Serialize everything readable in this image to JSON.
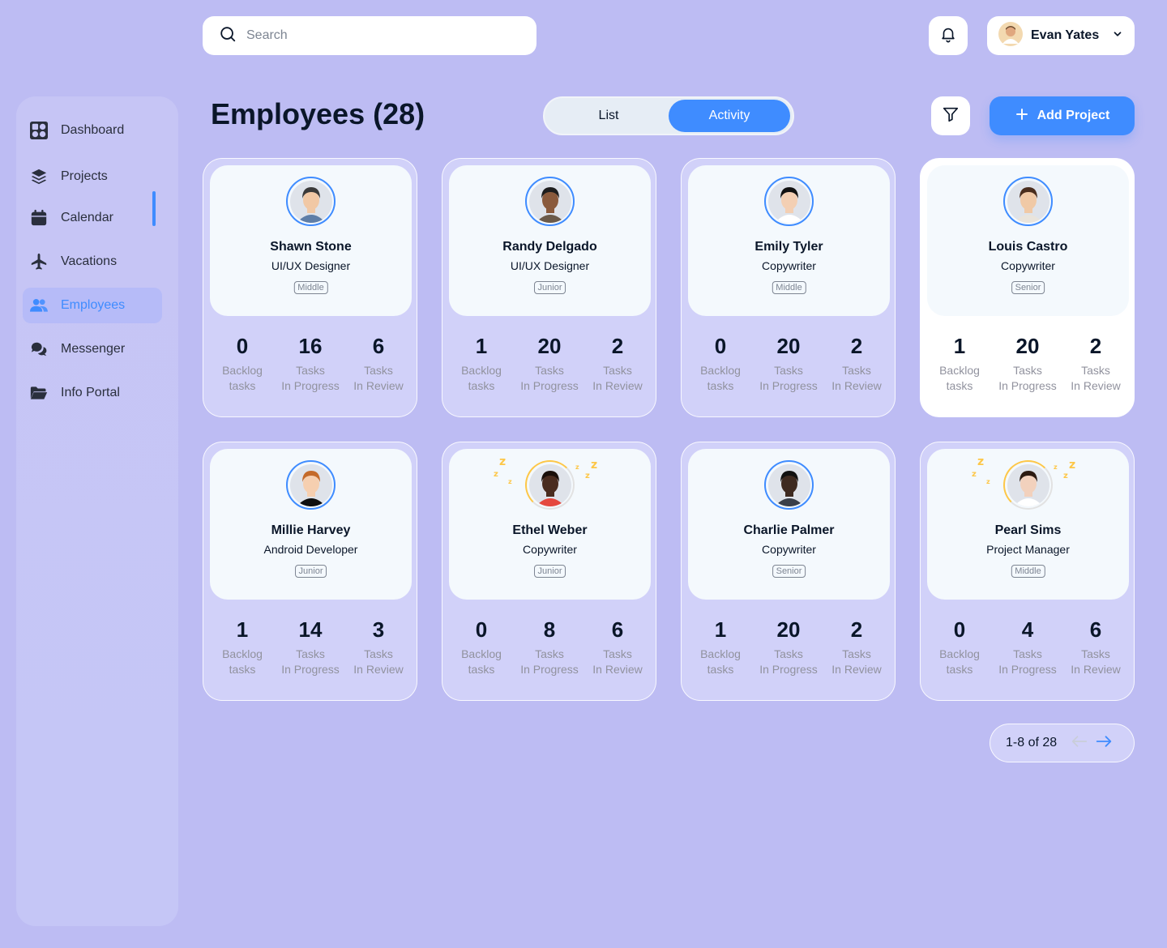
{
  "search": {
    "placeholder": "Search"
  },
  "user": {
    "name": "Evan Yates"
  },
  "sidebar": {
    "items": [
      {
        "label": "Dashboard",
        "icon": "dashboard-icon"
      },
      {
        "label": "Projects",
        "icon": "layers-icon"
      },
      {
        "label": "Calendar",
        "icon": "calendar-icon"
      },
      {
        "label": "Vacations",
        "icon": "airplane-icon"
      },
      {
        "label": "Employees",
        "icon": "users-icon",
        "active": true
      },
      {
        "label": "Messenger",
        "icon": "chat-icon"
      },
      {
        "label": "Info Portal",
        "icon": "folder-icon"
      }
    ]
  },
  "header": {
    "title": "Employees (28)",
    "view_toggle": {
      "list": "List",
      "activity": "Activity",
      "selected": "Activity"
    },
    "add_label": "Add Project"
  },
  "stat_labels": {
    "backlog_1": "Backlog",
    "backlog_2": "tasks",
    "progress_1": "Tasks",
    "progress_2": "In Progress",
    "review_1": "Tasks",
    "review_2": "In Review"
  },
  "employees": [
    {
      "name": "Shawn Stone",
      "role": "UI/UX Designer",
      "level": "Middle",
      "backlog": "0",
      "in_progress": "16",
      "in_review": "6",
      "status": "active"
    },
    {
      "name": "Randy Delgado",
      "role": "UI/UX Designer",
      "level": "Junior",
      "backlog": "1",
      "in_progress": "20",
      "in_review": "2",
      "status": "active"
    },
    {
      "name": "Emily Tyler",
      "role": "Copywriter",
      "level": "Middle",
      "backlog": "0",
      "in_progress": "20",
      "in_review": "2",
      "status": "active"
    },
    {
      "name": "Louis Castro",
      "role": "Copywriter",
      "level": "Senior",
      "backlog": "1",
      "in_progress": "20",
      "in_review": "2",
      "status": "active",
      "highlighted": true
    },
    {
      "name": "Millie Harvey",
      "role": "Android Developer",
      "level": "Junior",
      "backlog": "1",
      "in_progress": "14",
      "in_review": "3",
      "status": "active"
    },
    {
      "name": "Ethel Weber",
      "role": "Copywriter",
      "level": "Junior",
      "backlog": "0",
      "in_progress": "8",
      "in_review": "6",
      "status": "sleeping"
    },
    {
      "name": "Charlie Palmer",
      "role": "Copywriter",
      "level": "Senior",
      "backlog": "1",
      "in_progress": "20",
      "in_review": "2",
      "status": "active"
    },
    {
      "name": "Pearl Sims",
      "role": "Project Manager",
      "level": "Middle",
      "backlog": "0",
      "in_progress": "4",
      "in_review": "6",
      "status": "sleeping"
    }
  ],
  "pagination": {
    "label": "1-8 of 28"
  },
  "colors": {
    "accent": "#3f8cff",
    "background": "#bdbcf3",
    "sleep": "#fdc748",
    "text": "#0a1629"
  }
}
